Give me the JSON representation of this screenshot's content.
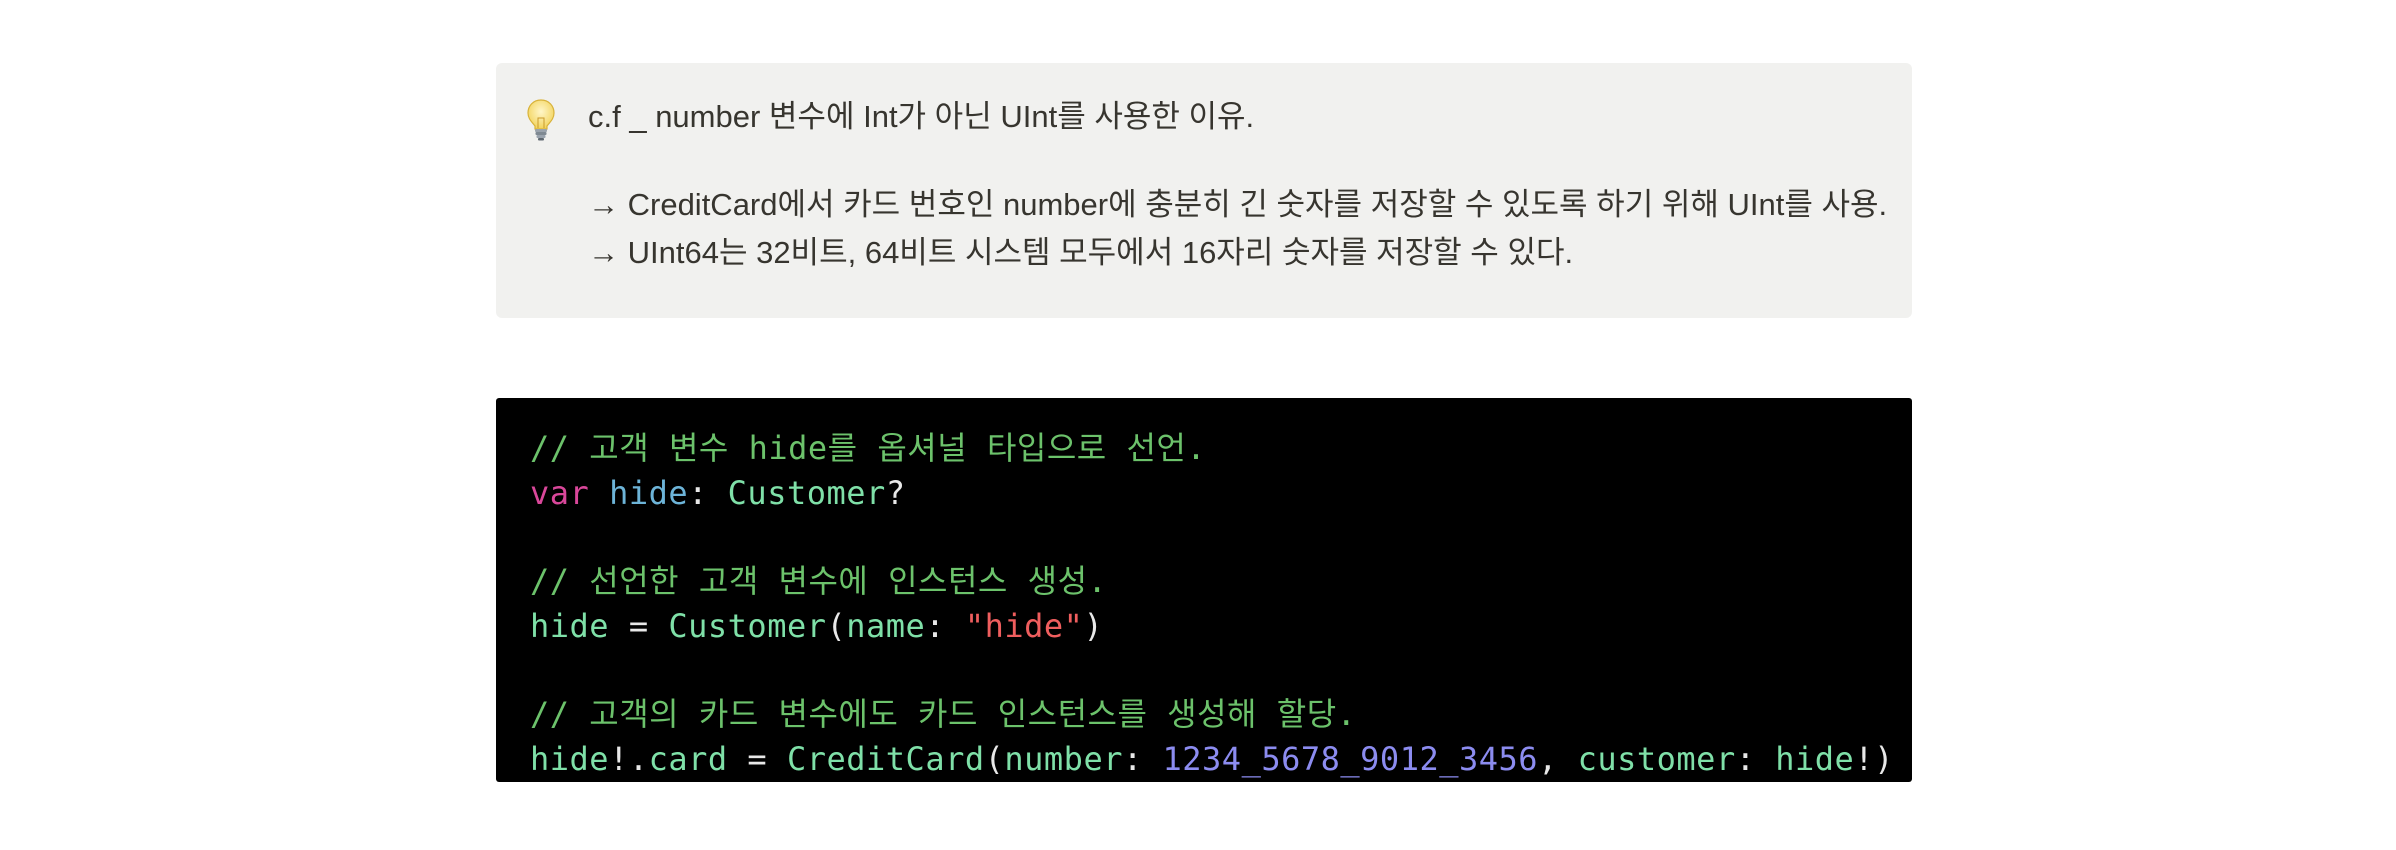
{
  "callout": {
    "icon": "lightbulb-icon",
    "title": "c.f _ number 변수에 Int가 아닌 UInt를 사용한 이유.",
    "lines": [
      "→ CreditCard에서 카드 번호인 number에 충분히 긴 숫자를 저장할 수 있도록 하기 위해 UInt를 사용.",
      "→ UInt64는 32비트, 64비트 시스템 모두에서 16자리 숫자를 저장할 수 있다."
    ]
  },
  "code": {
    "comment1": "// 고객 변수 hide를 옵셔널 타입으로 선언.",
    "line2": {
      "kw": "var",
      "sp": " ",
      "name": "hide",
      "colon": ": ",
      "type": "Customer",
      "q": "?"
    },
    "comment2": "// 선언한 고객 변수에 인스턴스 생성.",
    "line4": {
      "lhs": "hide",
      "eq": " = ",
      "type": "Customer",
      "open": "(",
      "label": "name",
      "colon": ": ",
      "str": "\"hide\"",
      "close": ")"
    },
    "comment3": "// 고객의 카드 변수에도 카드 인스턴스를 생성해 할당.",
    "line6": {
      "obj": "hide",
      "bang": "!.",
      "prop": "card",
      "eq": " = ",
      "type": "CreditCard",
      "open": "(",
      "label1": "number",
      "colon1": ": ",
      "num": "1234_5678_9012_3456",
      "comma": ", ",
      "label2": "customer",
      "colon2": ": ",
      "arg": "hide",
      "close": "!)"
    }
  },
  "colors": {
    "callout_bg": "#f1f1ef",
    "code_bg": "#000000",
    "comment": "#6cc26b",
    "keyword": "#d9479a",
    "string": "#ef5e5e",
    "number": "#8c8cf0"
  }
}
